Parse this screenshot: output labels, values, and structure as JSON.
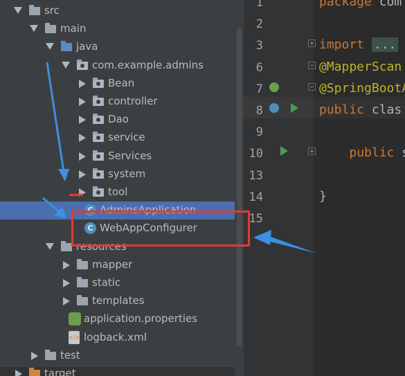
{
  "project_tree": {
    "items": [
      {
        "label": "src",
        "level": 0,
        "icon": "folder-icon",
        "expanded": true
      },
      {
        "label": "main",
        "level": 1,
        "icon": "folder-icon",
        "expanded": true
      },
      {
        "label": "java",
        "level": 2,
        "icon": "source-folder-icon",
        "expanded": true
      },
      {
        "label": "com.example.admins",
        "level": 3,
        "icon": "package-icon",
        "expanded": true
      },
      {
        "label": "Bean",
        "level": 4,
        "icon": "package-icon",
        "expanded": false
      },
      {
        "label": "controller",
        "level": 4,
        "icon": "package-icon",
        "expanded": false
      },
      {
        "label": "Dao",
        "level": 4,
        "icon": "package-icon",
        "expanded": false
      },
      {
        "label": "service",
        "level": 4,
        "icon": "package-icon",
        "expanded": false
      },
      {
        "label": "Services",
        "level": 4,
        "icon": "package-icon",
        "expanded": false
      },
      {
        "label": "system",
        "level": 4,
        "icon": "package-icon",
        "expanded": false
      },
      {
        "label": "tool",
        "level": 4,
        "icon": "package-icon",
        "expanded": false
      },
      {
        "label": "AdminsApplication",
        "level": 4,
        "icon": "spring-boot-class-icon",
        "selected": true
      },
      {
        "label": "WebAppConfigurer",
        "level": 4,
        "icon": "class-icon"
      },
      {
        "label": "resources",
        "level": 2,
        "icon": "resources-folder-icon",
        "expanded": true
      },
      {
        "label": "mapper",
        "level": 3,
        "icon": "folder-icon",
        "expanded": false
      },
      {
        "label": "static",
        "level": 3,
        "icon": "folder-icon",
        "expanded": false
      },
      {
        "label": "templates",
        "level": 3,
        "icon": "folder-icon",
        "expanded": false
      },
      {
        "label": "application.properties",
        "level": 3,
        "icon": "spring-properties-icon"
      },
      {
        "label": "logback.xml",
        "level": 3,
        "icon": "xml-file-icon"
      },
      {
        "label": "test",
        "level": 1,
        "icon": "folder-icon",
        "expanded": false
      },
      {
        "label": "target",
        "level": 0,
        "icon": "target-folder-icon",
        "expanded": false
      }
    ]
  },
  "editor": {
    "lines": [
      {
        "number": "1",
        "keyword": "package",
        "rest": " com"
      },
      {
        "number": "2"
      },
      {
        "number": "3",
        "keyword": "import",
        "rest": " ",
        "folded": "..."
      },
      {
        "number": "6",
        "annotation": "@MapperScan"
      },
      {
        "number": "7",
        "annotation": "@SpringBootA"
      },
      {
        "number": "8",
        "keyword": "public",
        "rest": " clas"
      },
      {
        "number": "9"
      },
      {
        "number": "10",
        "indent": "    ",
        "keyword": "public",
        "rest": " s"
      },
      {
        "number": "13"
      },
      {
        "number": "14",
        "rest": "}"
      },
      {
        "number": "15"
      }
    ]
  },
  "colors": {
    "tree_bg": "#3c3f41",
    "editor_bg": "#2b2b2b",
    "selection": "#4b6eaf",
    "keyword": "#cc7832",
    "annotation": "#bbb529",
    "highlight_rect": "#e53935",
    "pointer_arrow": "#3d8fe0"
  }
}
